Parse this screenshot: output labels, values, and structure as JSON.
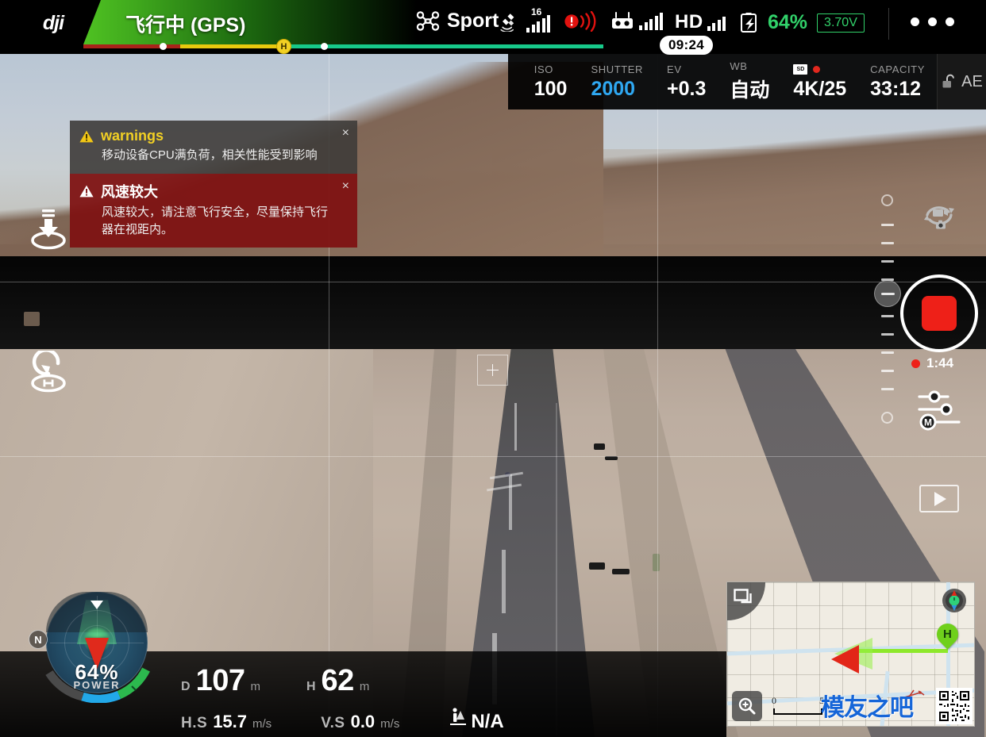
{
  "app": {
    "brand": "dji",
    "flight_status": "飞行中 (GPS)"
  },
  "topbar": {
    "flight_mode": "Sport",
    "flight_mode_icon": "drone-icon",
    "satellite_icon": "satellite-icon",
    "satellite_count": "16",
    "satellite_bars": 5,
    "obstacle_icon": "obstacle-sensing-warning-icon",
    "rc_icon": "remote-controller-icon",
    "rc_bars": 5,
    "hd_label": "HD",
    "hd_bars": 4,
    "battery_icon": "battery-icon",
    "battery_percent": "64%",
    "battery_voltage": "3.70V",
    "battery_color": "#31d16a",
    "menu_icon": "more-menu-icon",
    "battery_bar": {
      "home_marker": "H",
      "remaining_time": "09:24"
    }
  },
  "camera_bar": {
    "items": [
      {
        "label": "ISO",
        "value": "100"
      },
      {
        "label": "SHUTTER",
        "value": "2000"
      },
      {
        "label": "EV",
        "value": "+0.3"
      },
      {
        "label": "WB",
        "value": "自动"
      }
    ],
    "sd_label": "SD",
    "resolution": "4K/25",
    "capacity_label": "CAPACITY",
    "capacity_value": "33:12",
    "ae_label": "AE",
    "ae_icon": "unlocked-padlock-icon"
  },
  "warnings": [
    {
      "title": "warnings",
      "message": "移动设备CPU满负荷，相关性能受到影响",
      "close": "×",
      "icon": "warning-triangle-icon"
    },
    {
      "title": "风速较大",
      "message": "风速较大，请注意飞行安全，尽量保持飞行器在视距内。",
      "close": "×",
      "icon": "warning-triangle-icon"
    }
  ],
  "left_controls": [
    {
      "name": "auto-landing-button",
      "icon": "auto-landing-icon"
    },
    {
      "name": "return-to-home-button",
      "icon": "return-to-home-icon"
    }
  ],
  "right_controls": {
    "camera_mode_toggle_icon": "camera-video-switch-icon",
    "shutter_icon": "stop-recording-icon",
    "recording_time": "1:44",
    "settings_icon": "camera-settings-sliders-icon",
    "settings_mode": "M",
    "playback_icon": "playback-icon",
    "gimbal_slider_name": "gimbal-pitch-slider"
  },
  "focus_reticle": "focus-exposure-reticle",
  "telemetry": {
    "distance": {
      "key": "D",
      "value": "107",
      "unit": "m"
    },
    "altitude": {
      "key": "H",
      "value": "62",
      "unit": "m"
    },
    "h_speed": {
      "key": "H.S",
      "value": "15.7",
      "unit": "m/s"
    },
    "v_speed": {
      "key": "V.S",
      "value": "0.0",
      "unit": "m/s"
    },
    "vision": {
      "icon": "vision-system-icon",
      "value": "N/A"
    }
  },
  "radar": {
    "power_percent": "64%",
    "power_label": "POWER",
    "north_label": "N"
  },
  "minimap": {
    "layer_toggle_icon": "map-layer-toggle-icon",
    "compass_icon": "map-compass-icon",
    "zoom_icon": "zoom-in-icon",
    "home_marker": "H",
    "scale_min": "0",
    "scale_max": "5",
    "watermark": "模友之吧"
  }
}
